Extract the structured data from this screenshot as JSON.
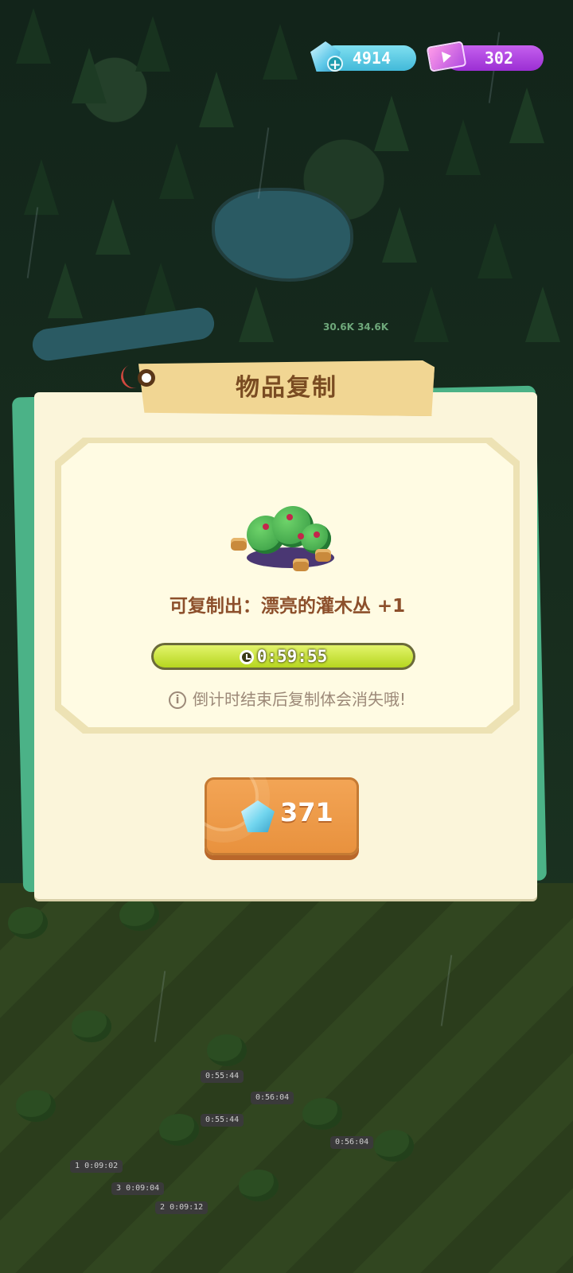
{
  "currency": {
    "gems": "4914",
    "tickets": "302",
    "gem_icon": "blue-gem-icon",
    "ticket_icon": "purple-ticket-icon"
  },
  "world": {
    "signpost_text": "30.6K 34.6K",
    "timers": [
      "0:55:44",
      "0:56:04",
      "0:55:44",
      "0:56:04",
      "0:09:02",
      "0:09:04",
      "0:09:12"
    ],
    "queue_numbers": [
      "1",
      "3",
      "2"
    ]
  },
  "dialog": {
    "title": "物品复制",
    "copy_label": "可复制出：漂亮的灌木丛  +1",
    "timer": "0:59:55",
    "timer_progress": 0.999,
    "notice": "倒计时结束后复制体会消失哦!",
    "price": "371",
    "item_icon": "pretty-bush-icon",
    "colors": {
      "accent": "#4bb287",
      "title": "#7a4c22",
      "button": "#ee9a48",
      "progress": "#c7e43a"
    }
  }
}
